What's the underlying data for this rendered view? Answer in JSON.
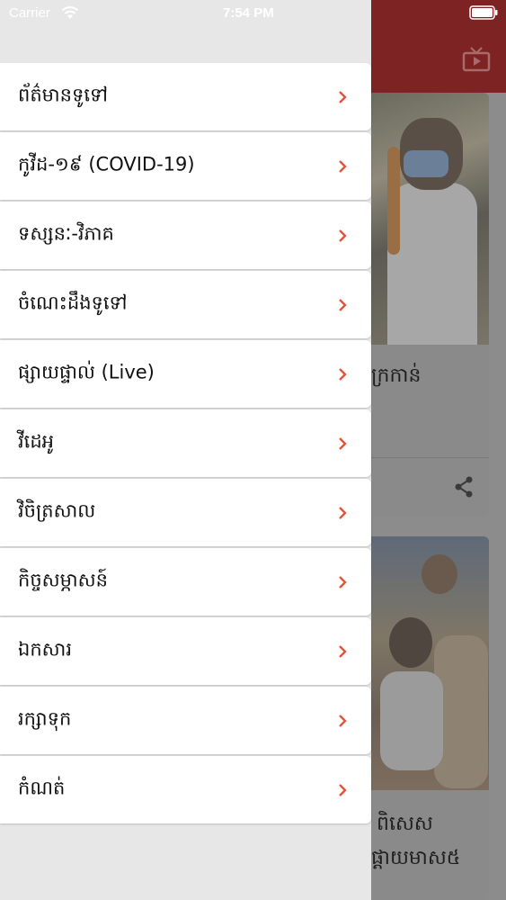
{
  "status_bar": {
    "carrier": "Carrier",
    "time": "7:54 PM"
  },
  "menu": {
    "items": [
      {
        "label": "ព័ត៌មានទូទៅ"
      },
      {
        "label": "កូវីដ-១៩ (COVID-19)"
      },
      {
        "label": "ទស្សនៈ-វិភាគ"
      },
      {
        "label": "ចំណេះដឹងទូទៅ"
      },
      {
        "label": "ផ្សាយផ្ទាល់ (Live)"
      },
      {
        "label": "វីដេអូ"
      },
      {
        "label": "វិចិត្រសាល"
      },
      {
        "label": "កិច្ចសម្ភាសន៍"
      },
      {
        "label": "ឯកសារ"
      },
      {
        "label": "រក្សាទុក"
      },
      {
        "label": "កំណត់"
      }
    ]
  },
  "background": {
    "card1_title": "ក្រកាន់",
    "card2_title_line1": "ពិសេស",
    "card2_title_line2": "ផ្ដាយមាស៥"
  },
  "colors": {
    "accent": "#e0563b",
    "header": "#7d2323"
  }
}
